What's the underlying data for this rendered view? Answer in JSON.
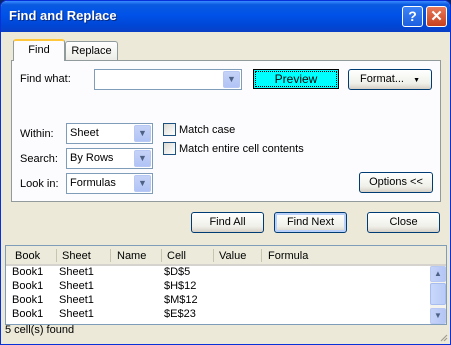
{
  "window": {
    "title": "Find and Replace"
  },
  "titlebar": {
    "help_glyph": "?",
    "close_glyph": "✕"
  },
  "tabs": [
    {
      "label": "Find",
      "active": true
    },
    {
      "label": "Replace",
      "active": false
    }
  ],
  "find": {
    "find_what_label": "Find what:",
    "find_what_value": "",
    "preview_label": "Preview",
    "format_label": "Format...",
    "within_label": "Within:",
    "within_value": "Sheet",
    "search_label": "Search:",
    "search_value": "By Rows",
    "lookin_label": "Look in:",
    "lookin_value": "Formulas",
    "match_case_label": "Match case",
    "match_case_checked": false,
    "match_entire_label": "Match entire cell contents",
    "match_entire_checked": false,
    "options_label": "Options <<"
  },
  "buttons": {
    "find_all": "Find All",
    "find_next": "Find Next",
    "close": "Close"
  },
  "results": {
    "columns": [
      "Book",
      "Sheet",
      "Name",
      "Cell",
      "Value",
      "Formula"
    ],
    "rows": [
      {
        "book": "Book1",
        "sheet": "Sheet1",
        "name": "",
        "cell": "$D$5",
        "value": "",
        "formula": ""
      },
      {
        "book": "Book1",
        "sheet": "Sheet1",
        "name": "",
        "cell": "$H$12",
        "value": "",
        "formula": ""
      },
      {
        "book": "Book1",
        "sheet": "Sheet1",
        "name": "",
        "cell": "$M$12",
        "value": "",
        "formula": ""
      },
      {
        "book": "Book1",
        "sheet": "Sheet1",
        "name": "",
        "cell": "$E$23",
        "value": "",
        "formula": ""
      }
    ]
  },
  "status": {
    "text": "5 cell(s) found"
  },
  "colors": {
    "titlebar": "#0052e8",
    "dialog": "#ece9d8",
    "preview_fill": "#00ffff",
    "close_button": "#c8401e"
  }
}
